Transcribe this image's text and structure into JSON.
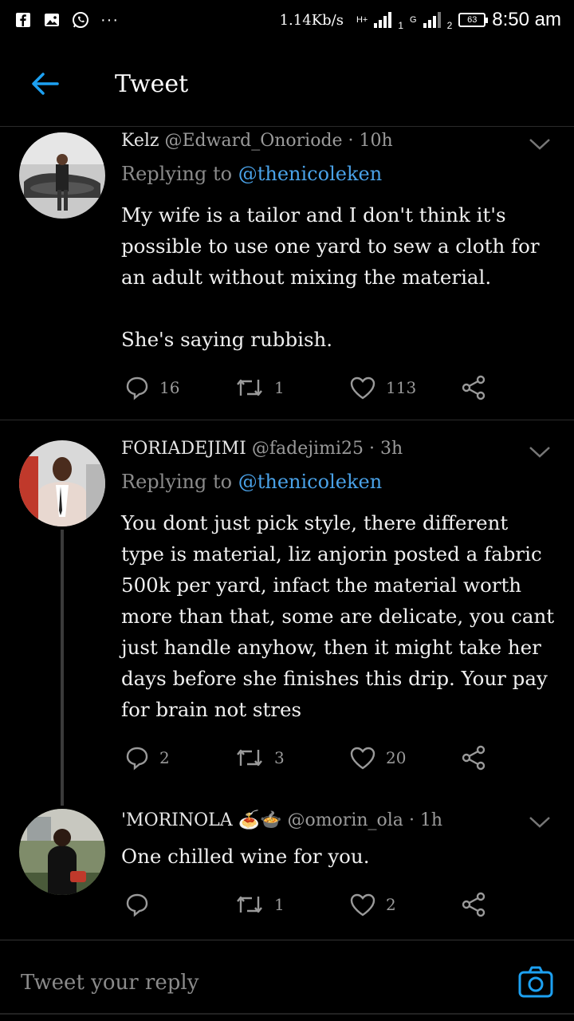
{
  "status_bar": {
    "network_speed": "1.14Kb/s",
    "sim1_label": "1",
    "sim2_label": "2",
    "hplus_label": "H+",
    "g_label": "G",
    "battery": "63",
    "time": "8:50 am",
    "dots": "···"
  },
  "header": {
    "title": "Tweet"
  },
  "tweets": [
    {
      "name": "Kelz",
      "handle": "@Edward_Onoriode",
      "time": "· 10h",
      "replying_prefix": "Replying to",
      "replying_handle": "@thenicoleken",
      "body": "My wife is a tailor and I don't think it's possible to use one yard to sew a cloth for an adult without mixing the material.\n\nShe's saying rubbish.",
      "replies": "16",
      "retweets": "1",
      "likes": "113"
    },
    {
      "name": "FORIADEJIMI",
      "handle": "@fadejimi25",
      "time": "· 3h",
      "replying_prefix": "Replying to",
      "replying_handle": "@thenicoleken",
      "body": "You dont just pick style, there different type is material, liz anjorin posted a fabric 500k per yard, infact the material worth more than that, some are delicate, you cant just handle anyhow, then it might take her days before she finishes this drip. Your pay for brain not stres",
      "replies": "2",
      "retweets": "3",
      "likes": "20"
    },
    {
      "name": "'MORINOLA",
      "emoji": "🍝🍲",
      "handle": "@omorin_ola",
      "time": "· 1h",
      "body": "One chilled wine for you.",
      "replies": "",
      "retweets": "1",
      "likes": "2"
    }
  ],
  "reply_bar": {
    "placeholder": "Tweet your reply"
  },
  "colors": {
    "link": "#4aa2e8",
    "background": "#000000",
    "muted": "#9a9a9a"
  }
}
